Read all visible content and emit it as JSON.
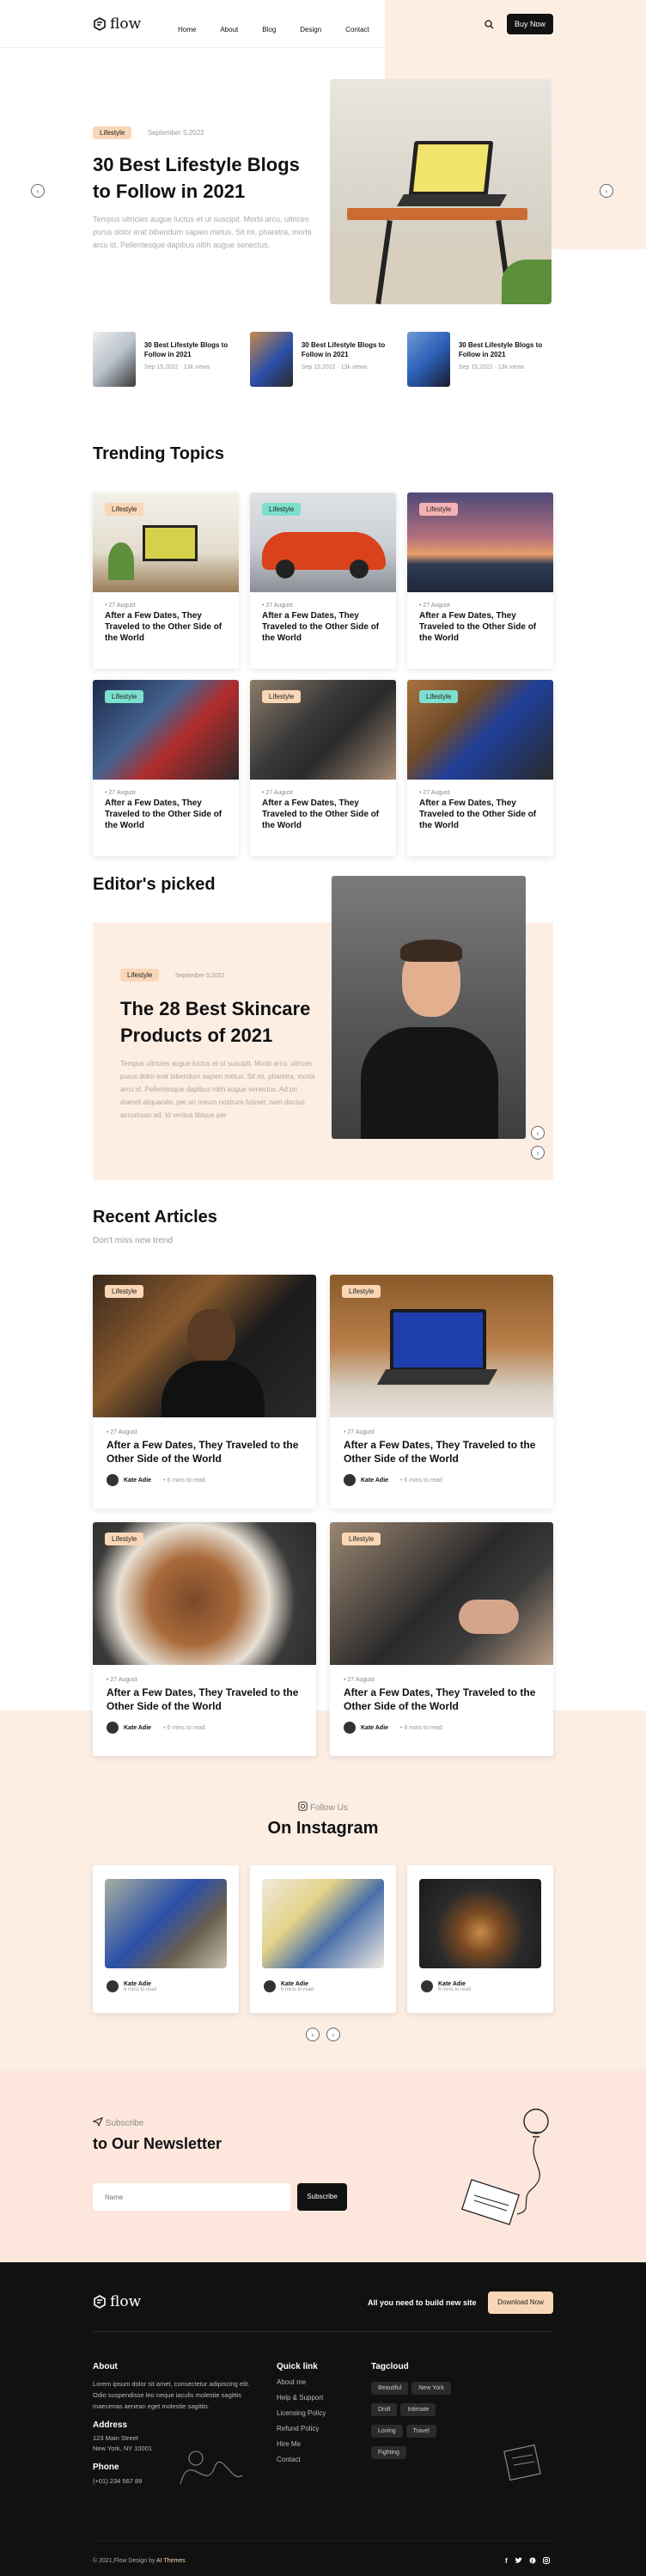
{
  "header": {
    "logo": "flow",
    "nav": [
      "Home",
      "About",
      "Blog",
      "Design",
      "Contact"
    ],
    "buy": "Buy Now"
  },
  "hero": {
    "tag": "Lifestyle",
    "date": "September 5,2022",
    "title": "30 Best Lifestyle Blogs to Follow in 2021",
    "text": "Tempus ultricies augue luctus et ut suscipit. Morbi arcu, ultrices purus dolor erat bibendum sapien metus. Sit mi, pharetra, morbi arcu id. Pellentesque dapibus nibh augue senectus."
  },
  "mini": [
    {
      "title": "30 Best Lifestyle Blogs to Follow in 2021",
      "date": "Sep 15,2022",
      "views": "13k views"
    },
    {
      "title": "30 Best Lifestyle Blogs to Follow in 2021",
      "date": "Sep 15,2022",
      "views": "13k views"
    },
    {
      "title": "30 Best Lifestyle Blogs to Follow in 2021",
      "date": "Sep 15,2022",
      "views": "13k views"
    }
  ],
  "trending": {
    "title": "Trending Topics",
    "cards": [
      {
        "tag": "Lifestyle",
        "date": "27 August",
        "title": "After a Few Dates, They Traveled to the Other Side of the World"
      },
      {
        "tag": "Lifestyle",
        "date": "27 August",
        "title": "After a Few Dates, They Traveled to the Other Side of the World"
      },
      {
        "tag": "Lifestyle",
        "date": "27 August",
        "title": "After a Few Dates, They Traveled to the Other Side of the World"
      },
      {
        "tag": "Lifestyle",
        "date": "27 August",
        "title": "After a Few Dates, They Traveled to the Other Side of the World"
      },
      {
        "tag": "Lifestyle",
        "date": "27 August",
        "title": "After a Few Dates, They Traveled to the Other Side of the World"
      },
      {
        "tag": "Lifestyle",
        "date": "27 August",
        "title": "After a Few Dates, They Traveled to the Other Side of the World"
      }
    ]
  },
  "editor": {
    "title": "Editor's picked",
    "tag": "Lifestyle",
    "date": "September 5,2022",
    "headline": "The 28 Best Skincare Products of 2021",
    "text": "Tempus ultricies augue luctus et ut suscipit. Morbi arcu, ultrices purus dolor erat bibendum sapien metus. Sit mi, pharetra, morbi arcu id. Pellentesque dapibus nibh augue senectus. Ad pri doendl aliquando, per an meum nostrum fuisset, nam doctus accumsan ad. Id veritus libique per"
  },
  "recent": {
    "title": "Recent Articles",
    "subtitle": "Don't miss new trend",
    "cards": [
      {
        "tag": "Lifestyle",
        "date": "27 August",
        "title": "After a Few Dates, They Traveled to the Other Side of the World",
        "author": "Kate Adie",
        "read": "6 mins to read"
      },
      {
        "tag": "Lifestyle",
        "date": "27 August",
        "title": "After a Few Dates, They Traveled to the Other Side of the World",
        "author": "Kate Adie",
        "read": "6 mins to read"
      },
      {
        "tag": "Lifestyle",
        "date": "27 August",
        "title": "After a Few Dates, They Traveled to the Other Side of the World",
        "author": "Kate Adie",
        "read": "6 mins to read"
      },
      {
        "tag": "Lifestyle",
        "date": "27 August",
        "title": "After a Few Dates, They Traveled to the Other Side of the World",
        "author": "Kate Adie",
        "read": "6 mins to read"
      }
    ]
  },
  "instagram": {
    "follow": "Follow Us",
    "title": "On Instagram",
    "cards": [
      {
        "author": "Kate Adie",
        "read": "6 mins to read"
      },
      {
        "author": "Kate Adie",
        "read": "6 mins to read"
      },
      {
        "author": "Kate Adie",
        "read": "6 mins to read"
      }
    ]
  },
  "newsletter": {
    "label": "Subscribe",
    "title": "to Our Newsletter",
    "placeholder": "Name",
    "button": "Subscribe"
  },
  "footer": {
    "logo": "flow",
    "cta_text": "All you need to build new site",
    "cta_button": "Download Now",
    "about_h": "About",
    "about": "Lorem ipsum dolor sit amet, consectetur adipiscing elit. Odio suspendisse leo neque iaculis molestie sagittis maecenas aenean eget molestie sagittis.",
    "address_h": "Address",
    "address1": "123 Main Street",
    "address2": "New York, NY 10001",
    "phone_h": "Phone",
    "phone": "(+01) 234 567 89",
    "quick_h": "Quick link",
    "quick": [
      "About me",
      "Help & Support",
      "Licensing Policy",
      "Refund Policy",
      "Hire Me",
      "Contact"
    ],
    "tag_h": "Tagcloud",
    "tags": [
      "Beautiful",
      "New York",
      "Droll",
      "Intimate",
      "Loving",
      "Travel",
      "Fighting"
    ],
    "copy_prefix": "© 2021,Flow Design by ",
    "copy_brand": "AI Themes"
  },
  "colors": {
    "accent": "#f9d7b6",
    "peach_bg": "#fdeee4",
    "dark": "#111111",
    "teal_tag": "#7de0cf",
    "pink_tag": "#f5b2b2"
  }
}
